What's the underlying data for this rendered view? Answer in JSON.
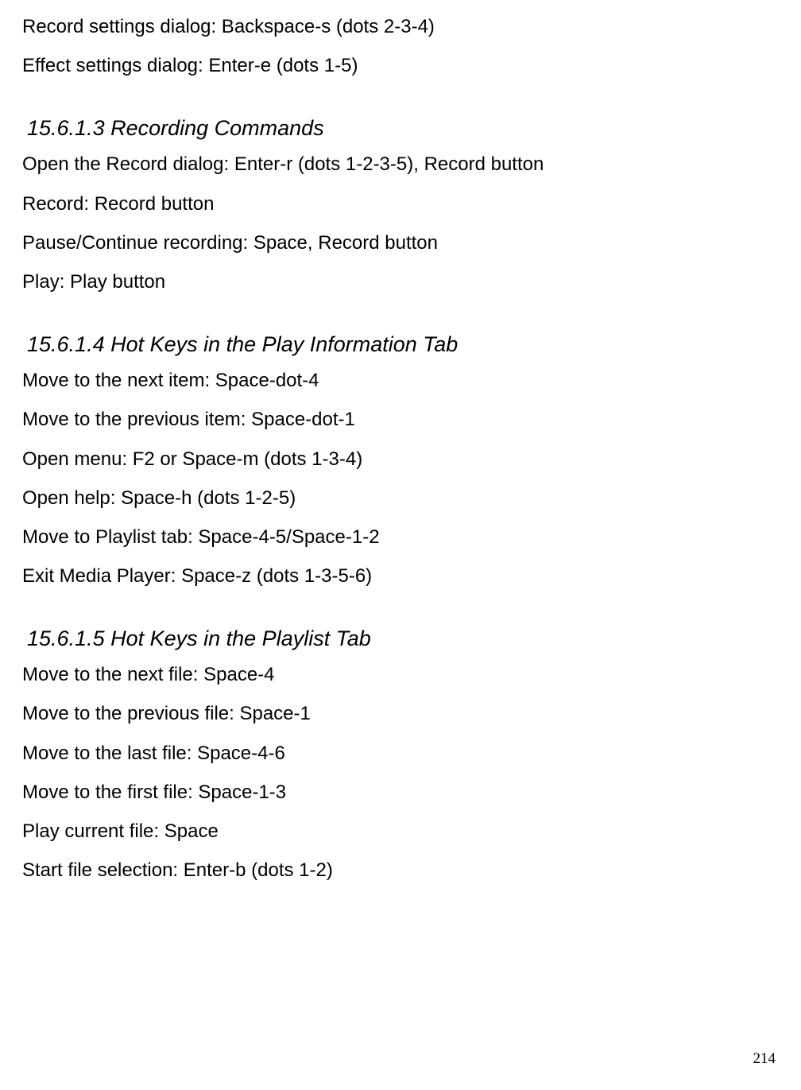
{
  "intro_lines": [
    "Record settings dialog: Backspace-s (dots 2-3-4)",
    "Effect settings dialog: Enter-e (dots 1-5)"
  ],
  "sections": [
    {
      "heading": "15.6.1.3 Recording Commands",
      "items": [
        "Open the Record dialog: Enter-r (dots 1-2-3-5), Record button",
        "Record: Record button",
        "Pause/Continue recording: Space, Record button",
        "Play: Play button"
      ]
    },
    {
      "heading": "15.6.1.4 Hot Keys in the Play Information Tab",
      "items": [
        "Move to the next item: Space-dot-4",
        "Move to the previous item: Space-dot-1",
        "Open menu: F2 or Space-m (dots 1-3-4)",
        "Open help: Space-h (dots 1-2-5)",
        "Move to Playlist tab: Space-4-5/Space-1-2",
        "Exit Media Player: Space-z (dots 1-3-5-6)"
      ]
    },
    {
      "heading": "15.6.1.5 Hot Keys in the Playlist Tab",
      "items": [
        "Move to the next file: Space-4",
        "Move to the previous file: Space-1",
        "Move to the last file: Space-4-6",
        "Move to the first file: Space-1-3",
        "Play current file: Space",
        "Start file selection: Enter-b (dots 1-2)"
      ]
    }
  ],
  "page_number": "214"
}
